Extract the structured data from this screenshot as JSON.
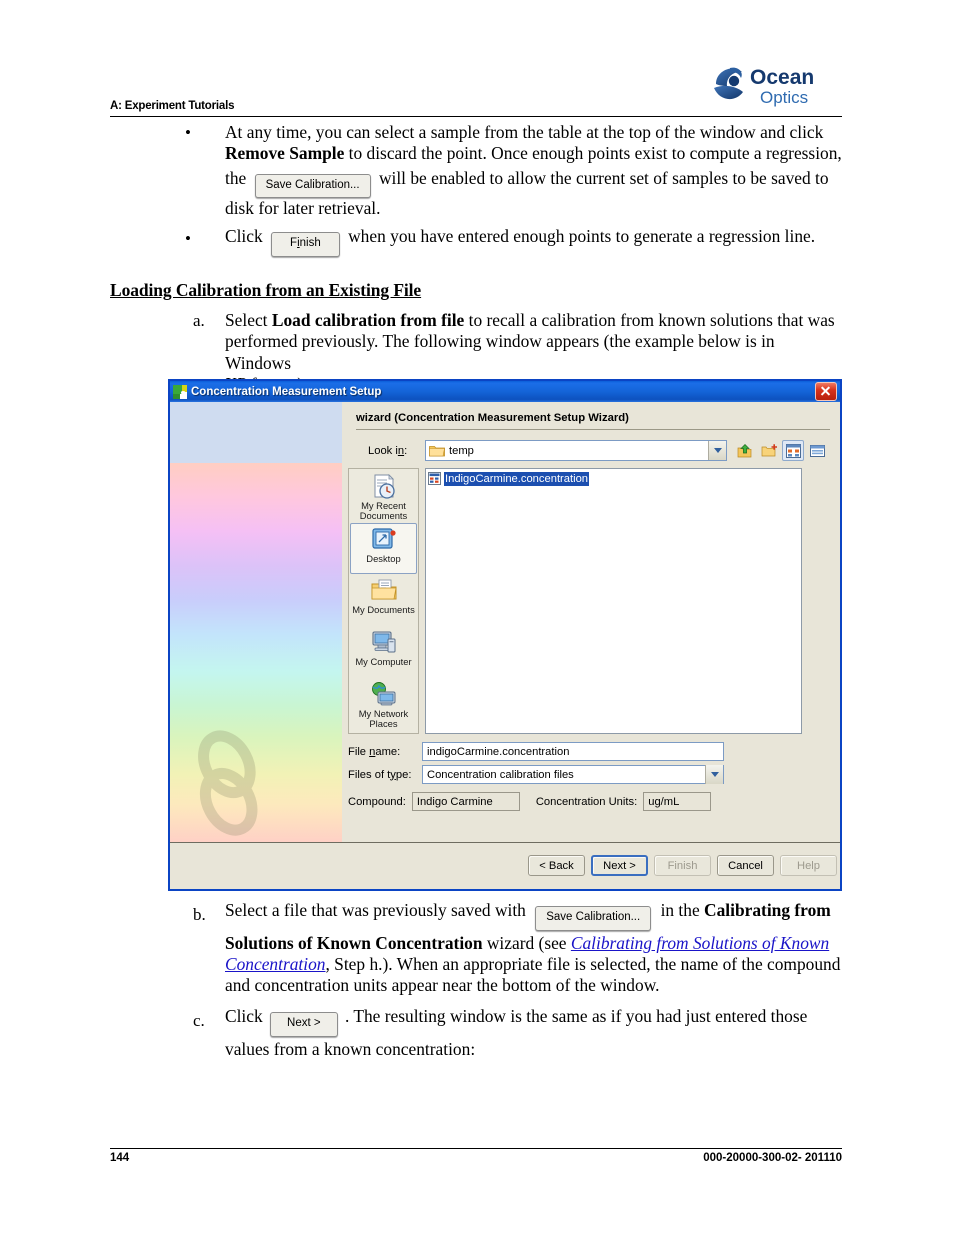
{
  "header": {
    "section_title": "A: Experiment Tutorials",
    "logo_line1": "Ocean",
    "logo_line2": "Optics"
  },
  "body": {
    "bullet1_line1": "At any time, you can select a sample from the table at the top of the window and click",
    "bullet1_bold": "Remove Sample",
    "bullet1_line2b": " to discard the point.  Once enough points exist to compute a regression,",
    "bullet1_line3a": "the",
    "bullet1_btn": "Save Calibration...",
    "bullet1_line3b": "will be enabled to allow the current set of samples to be saved to",
    "bullet1_line4": "disk for later retrieval.",
    "bullet2_a": "Click",
    "bullet2_btn_pre": "F",
    "bullet2_btn_acc": "i",
    "bullet2_btn_post": "nish",
    "bullet2_btn_full": "Finish",
    "bullet2_b": "when you have entered enough points to generate a regression line.",
    "section_heading": "Loading Calibration from an Existing File",
    "step_a_marker": "a.",
    "step_a_1a": "Select ",
    "step_a_bold": "Load calibration from file",
    "step_a_1b": " to recall a calibration from known solutions that was",
    "step_a_2": "performed previously. The following window appears (the example below is in Windows",
    "step_a_3": "XP format):",
    "step_b_marker": "b.",
    "step_b_1a": "Select a file that was previously saved with",
    "step_b_btn": "Save Calibration...",
    "step_b_1b": "in the ",
    "step_b_bold1": "Calibrating from",
    "step_b_bold2": "Solutions of Known Concentration",
    "step_b_2b": " wizard (see ",
    "step_b_link1": "Calibrating from Solutions of Known",
    "step_b_link2": "Concentration",
    "step_b_3": ", Step h.). When an appropriate file is selected, the name of the compound",
    "step_b_4": "and concentration units appear near the bottom of the window.",
    "step_c_marker": "c.",
    "step_c_1a": "Click",
    "step_c_btn": "Next >",
    "step_c_1b": ".  The resulting window is the same as if you had just entered those",
    "step_c_2": "values from a known concentration:"
  },
  "dialog": {
    "title": "Concentration Measurement Setup",
    "app_icon": "app-icon",
    "close_icon": "close-icon",
    "wizard_label": "wizard (Concentration Measurement Setup Wizard)",
    "lookin_label_pre": "Look i",
    "lookin_label_acc": "n",
    "lookin_label_post": ":",
    "lookin_value": "temp",
    "toolbar": [
      {
        "name": "up-one-level-icon",
        "selected": false
      },
      {
        "name": "new-folder-icon",
        "selected": false
      },
      {
        "name": "list-view-icon",
        "selected": true
      },
      {
        "name": "details-view-icon",
        "selected": false
      }
    ],
    "places": [
      {
        "label": "My Recent\nDocuments",
        "icon": "recent-documents-icon",
        "selected": false
      },
      {
        "label": "Desktop",
        "icon": "desktop-icon",
        "selected": true
      },
      {
        "label": "My Documents",
        "icon": "my-documents-icon",
        "selected": false
      },
      {
        "label": "My Computer",
        "icon": "my-computer-icon",
        "selected": false
      },
      {
        "label": "My Network\nPlaces",
        "icon": "network-places-icon",
        "selected": false
      }
    ],
    "files": [
      {
        "name": "IndigoCarmine.concentration",
        "selected": true,
        "icon": "concentration-file-icon"
      }
    ],
    "filename_label_pre": "File ",
    "filename_label_acc": "n",
    "filename_label_post": "ame:",
    "filename_value": "indigoCarmine.concentration",
    "filetype_label_pre": "Files of t",
    "filetype_label_acc": "y",
    "filetype_label_post": "pe:",
    "filetype_value": "Concentration calibration files",
    "compound_label": "Compound:",
    "compound_value": "Indigo Carmine",
    "units_label": "Concentration Units:",
    "units_value": "ug/mL",
    "buttons": [
      {
        "label": "< Back",
        "state": "normal"
      },
      {
        "label": "Next >",
        "state": "default"
      },
      {
        "label": "Finish",
        "state": "disabled"
      },
      {
        "label": "Cancel",
        "state": "normal"
      },
      {
        "label": "Help",
        "state": "disabled"
      }
    ]
  },
  "footer": {
    "page_number": "144",
    "doc_number": "000-20000-300-02- 201110"
  },
  "colors": {
    "title_bar": "#1464d8",
    "dialog_border": "#0b44c4",
    "selection": "#1c4fb0",
    "link": "#1a14c8",
    "brand_blue": "#1b3f7a"
  }
}
